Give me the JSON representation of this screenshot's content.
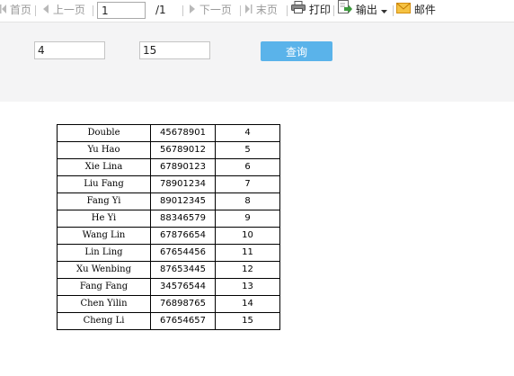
{
  "toolbar": {
    "first_label": "首页",
    "prev_label": "上一页",
    "page_value": "1",
    "total_pages": "/1",
    "next_label": "下一页",
    "last_label": "末页",
    "print_label": "打印",
    "export_label": "输出",
    "mail_label": "邮件"
  },
  "query": {
    "field1_value": "4",
    "field2_value": "15",
    "button_label": "查询"
  },
  "table": {
    "rows": [
      {
        "name": "Double",
        "phone": "45678901",
        "id": "4"
      },
      {
        "name": "Yu Hao",
        "phone": "56789012",
        "id": "5"
      },
      {
        "name": "Xie Lina",
        "phone": "67890123",
        "id": "6"
      },
      {
        "name": "Liu Fang",
        "phone": "78901234",
        "id": "7"
      },
      {
        "name": "Fang Yi",
        "phone": "89012345",
        "id": "8"
      },
      {
        "name": "He Yi",
        "phone": "88346579",
        "id": "9"
      },
      {
        "name": "Wang Lin",
        "phone": "67876654",
        "id": "10"
      },
      {
        "name": "Lin Ling",
        "phone": "67654456",
        "id": "11"
      },
      {
        "name": "Xu Wenbing",
        "phone": "87653445",
        "id": "12"
      },
      {
        "name": "Fang Fang",
        "phone": "34576544",
        "id": "13"
      },
      {
        "name": "Chen Yilin",
        "phone": "76898765",
        "id": "14"
      },
      {
        "name": "Cheng Li",
        "phone": "67654657",
        "id": "15"
      }
    ]
  },
  "colors": {
    "query_button": "#5ab3ea",
    "panel_background": "#f4f4f5",
    "disabled_text": "#9a9a9a"
  }
}
